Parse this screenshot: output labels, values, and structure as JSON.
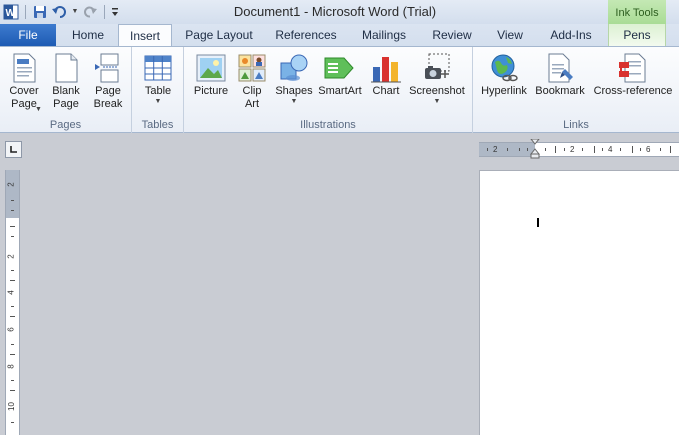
{
  "titlebar": {
    "title": "Document1  -  Microsoft Word (Trial)",
    "ink_tools": "Ink Tools"
  },
  "tabs": [
    "File",
    "Home",
    "Insert",
    "Page Layout",
    "References",
    "Mailings",
    "Review",
    "View",
    "Add-Ins",
    "Pens"
  ],
  "active_tab": "Insert",
  "ribbon": {
    "pages": {
      "label": "Pages",
      "cover_page": "Cover\nPage",
      "blank_page": "Blank\nPage",
      "page_break": "Page\nBreak"
    },
    "tables": {
      "label": "Tables",
      "table": "Table"
    },
    "illustrations": {
      "label": "Illustrations",
      "picture": "Picture",
      "clip_art": "Clip\nArt",
      "shapes": "Shapes",
      "smartart": "SmartArt",
      "chart": "Chart",
      "screenshot": "Screenshot"
    },
    "links": {
      "label": "Links",
      "hyperlink": "Hyperlink",
      "bookmark": "Bookmark",
      "cross_reference": "Cross-reference"
    }
  },
  "hruler": {
    "numbers": [
      "2",
      "2",
      "4",
      "6"
    ]
  },
  "vruler": {
    "numbers": [
      "2",
      "2",
      "4",
      "6",
      "8",
      "10"
    ]
  }
}
